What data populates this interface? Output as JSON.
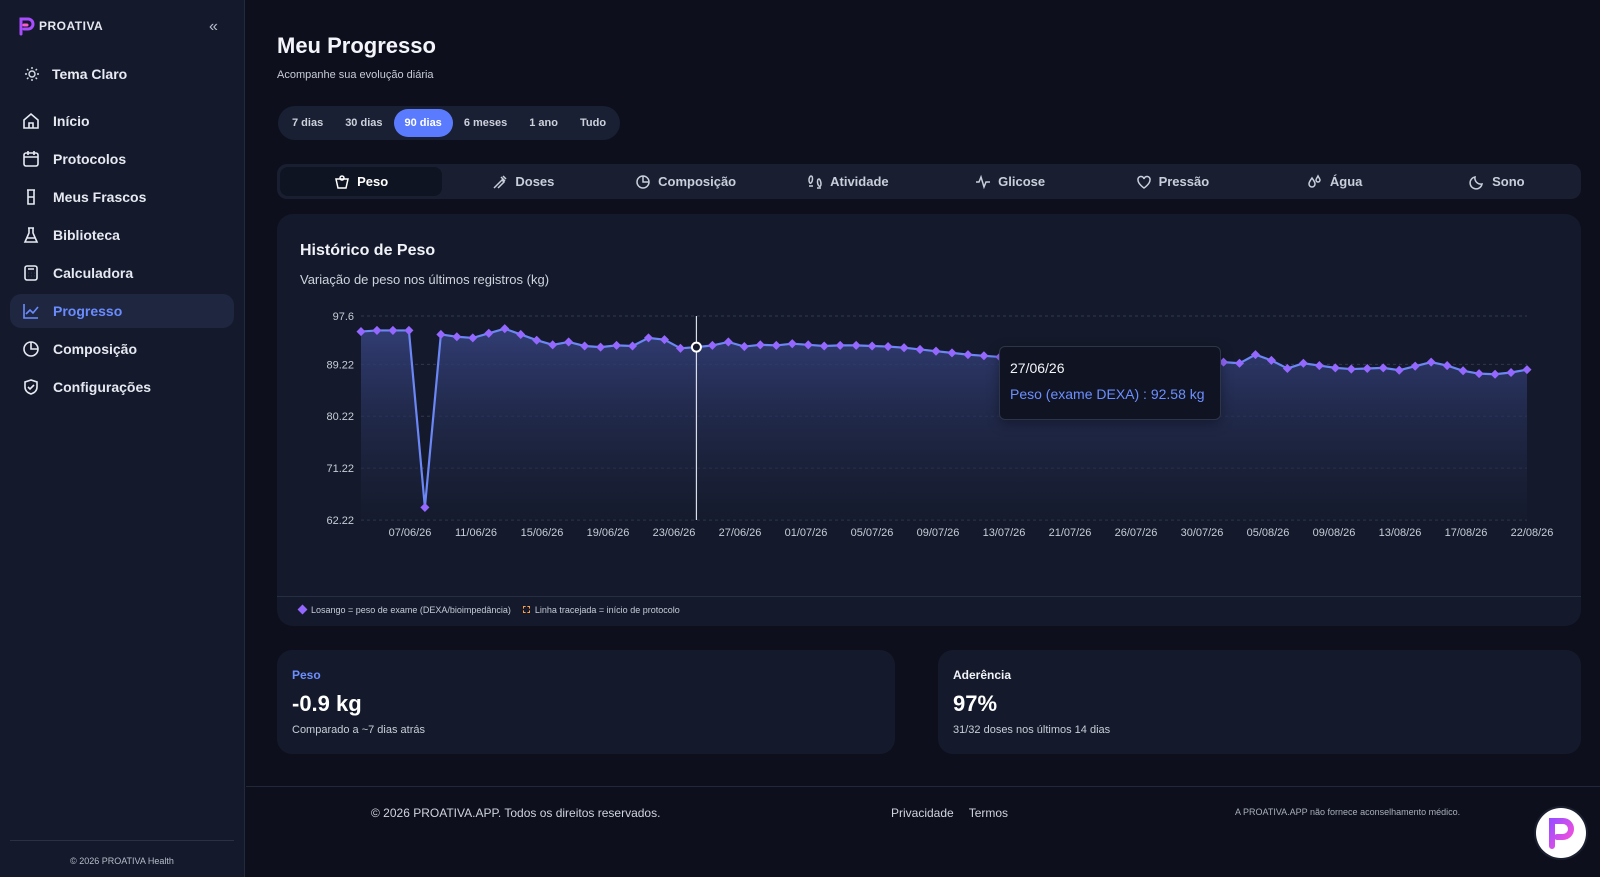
{
  "brand": {
    "name": "PROATIVA"
  },
  "sidebar": {
    "theme_label": "Tema Claro",
    "items": [
      {
        "label": "Início",
        "icon": "home-icon"
      },
      {
        "label": "Protocolos",
        "icon": "calendar-icon"
      },
      {
        "label": "Meus Frascos",
        "icon": "vial-icon"
      },
      {
        "label": "Biblioteca",
        "icon": "flask-icon"
      },
      {
        "label": "Calculadora",
        "icon": "calculator-icon"
      },
      {
        "label": "Progresso",
        "icon": "line-chart-icon",
        "active": true
      },
      {
        "label": "Composição",
        "icon": "pie-chart-icon"
      },
      {
        "label": "Configurações",
        "icon": "shield-icon"
      }
    ],
    "footer": "© 2026 PROATIVA Health"
  },
  "page": {
    "title": "Meu Progresso",
    "subtitle": "Acompanhe sua evolução diária"
  },
  "periods": [
    "7 dias",
    "30 dias",
    "90 dias",
    "6 meses",
    "1 ano",
    "Tudo"
  ],
  "selected_period": "90 dias",
  "tabs": [
    {
      "label": "Peso",
      "icon": "scale-icon",
      "active": true
    },
    {
      "label": "Doses",
      "icon": "syringe-icon"
    },
    {
      "label": "Composição",
      "icon": "pie-chart-icon"
    },
    {
      "label": "Atividade",
      "icon": "footprints-icon"
    },
    {
      "label": "Glicose",
      "icon": "pulse-icon"
    },
    {
      "label": "Pressão",
      "icon": "heart-icon"
    },
    {
      "label": "Água",
      "icon": "droplets-icon"
    },
    {
      "label": "Sono",
      "icon": "moon-icon"
    }
  ],
  "chart_card": {
    "title": "Histórico de Peso",
    "subtitle": "Variação de peso nos últimos registros (kg)",
    "legend_diamond": "Losango = peso de exame (DEXA/bioimpedância)",
    "legend_dashed": "Linha tracejada = início de protocolo"
  },
  "tooltip": {
    "date": "27/06/26",
    "value": "Peso (exame DEXA) : 92.58 kg"
  },
  "chart_data": {
    "type": "area",
    "title": "Histórico de Peso",
    "xlabel": "",
    "ylabel": "",
    "yticks": [
      97.6,
      89.22,
      80.22,
      71.22,
      62.22
    ],
    "ylim": [
      62.22,
      97.6
    ],
    "x_tick_labels": [
      "07/06/26",
      "11/06/26",
      "15/06/26",
      "19/06/26",
      "23/06/26",
      "27/06/26",
      "01/07/26",
      "05/07/26",
      "09/07/26",
      "13/07/26",
      "21/07/26",
      "26/07/26",
      "30/07/26",
      "05/08/26",
      "09/08/26",
      "13/08/26",
      "17/08/26",
      "22/08/26"
    ],
    "series": [
      {
        "values": [
          94.9,
          95.1,
          95.1,
          95.1,
          64.4,
          94.4,
          94.0,
          93.8,
          94.6,
          95.4,
          94.4,
          93.4,
          92.6,
          93.1,
          92.4,
          92.2,
          92.5,
          92.4,
          93.8,
          93.5,
          92.0,
          92.2,
          92.5,
          93.1,
          92.3,
          92.6,
          92.5,
          92.8,
          92.6,
          92.4,
          92.5,
          92.5,
          92.4,
          92.3,
          92.1,
          91.8,
          91.5,
          91.2,
          90.9,
          90.7,
          90.5,
          90.2,
          91.4,
          89.9,
          90.6,
          90.8,
          90.9,
          90.3,
          90.1,
          90.0,
          89.9,
          90.5,
          90.4,
          90.5,
          89.6,
          89.4,
          90.9,
          89.9,
          88.5,
          89.4,
          89.0,
          88.6,
          88.4,
          88.5,
          88.6,
          88.2,
          88.9,
          89.6,
          89.0,
          88.1,
          87.6,
          87.5,
          87.8,
          88.3
        ]
      }
    ],
    "grid": true,
    "color": "#6b86f5",
    "marker_color": "#9467ff"
  },
  "stats": [
    {
      "label": "Peso",
      "value": "-0.9 kg",
      "caption": "Comparado a ~7 dias atrás"
    },
    {
      "label": "Aderência",
      "value": "97%",
      "caption": "31/32 doses nos últimos 14 dias"
    }
  ],
  "footer": {
    "copyright": "© 2026 PROATIVA.APP. Todos os direitos reservados.",
    "privacy": "Privacidade",
    "terms": "Termos",
    "disclaimer": "A PROATIVA.APP não fornece aconselhamento médico."
  }
}
